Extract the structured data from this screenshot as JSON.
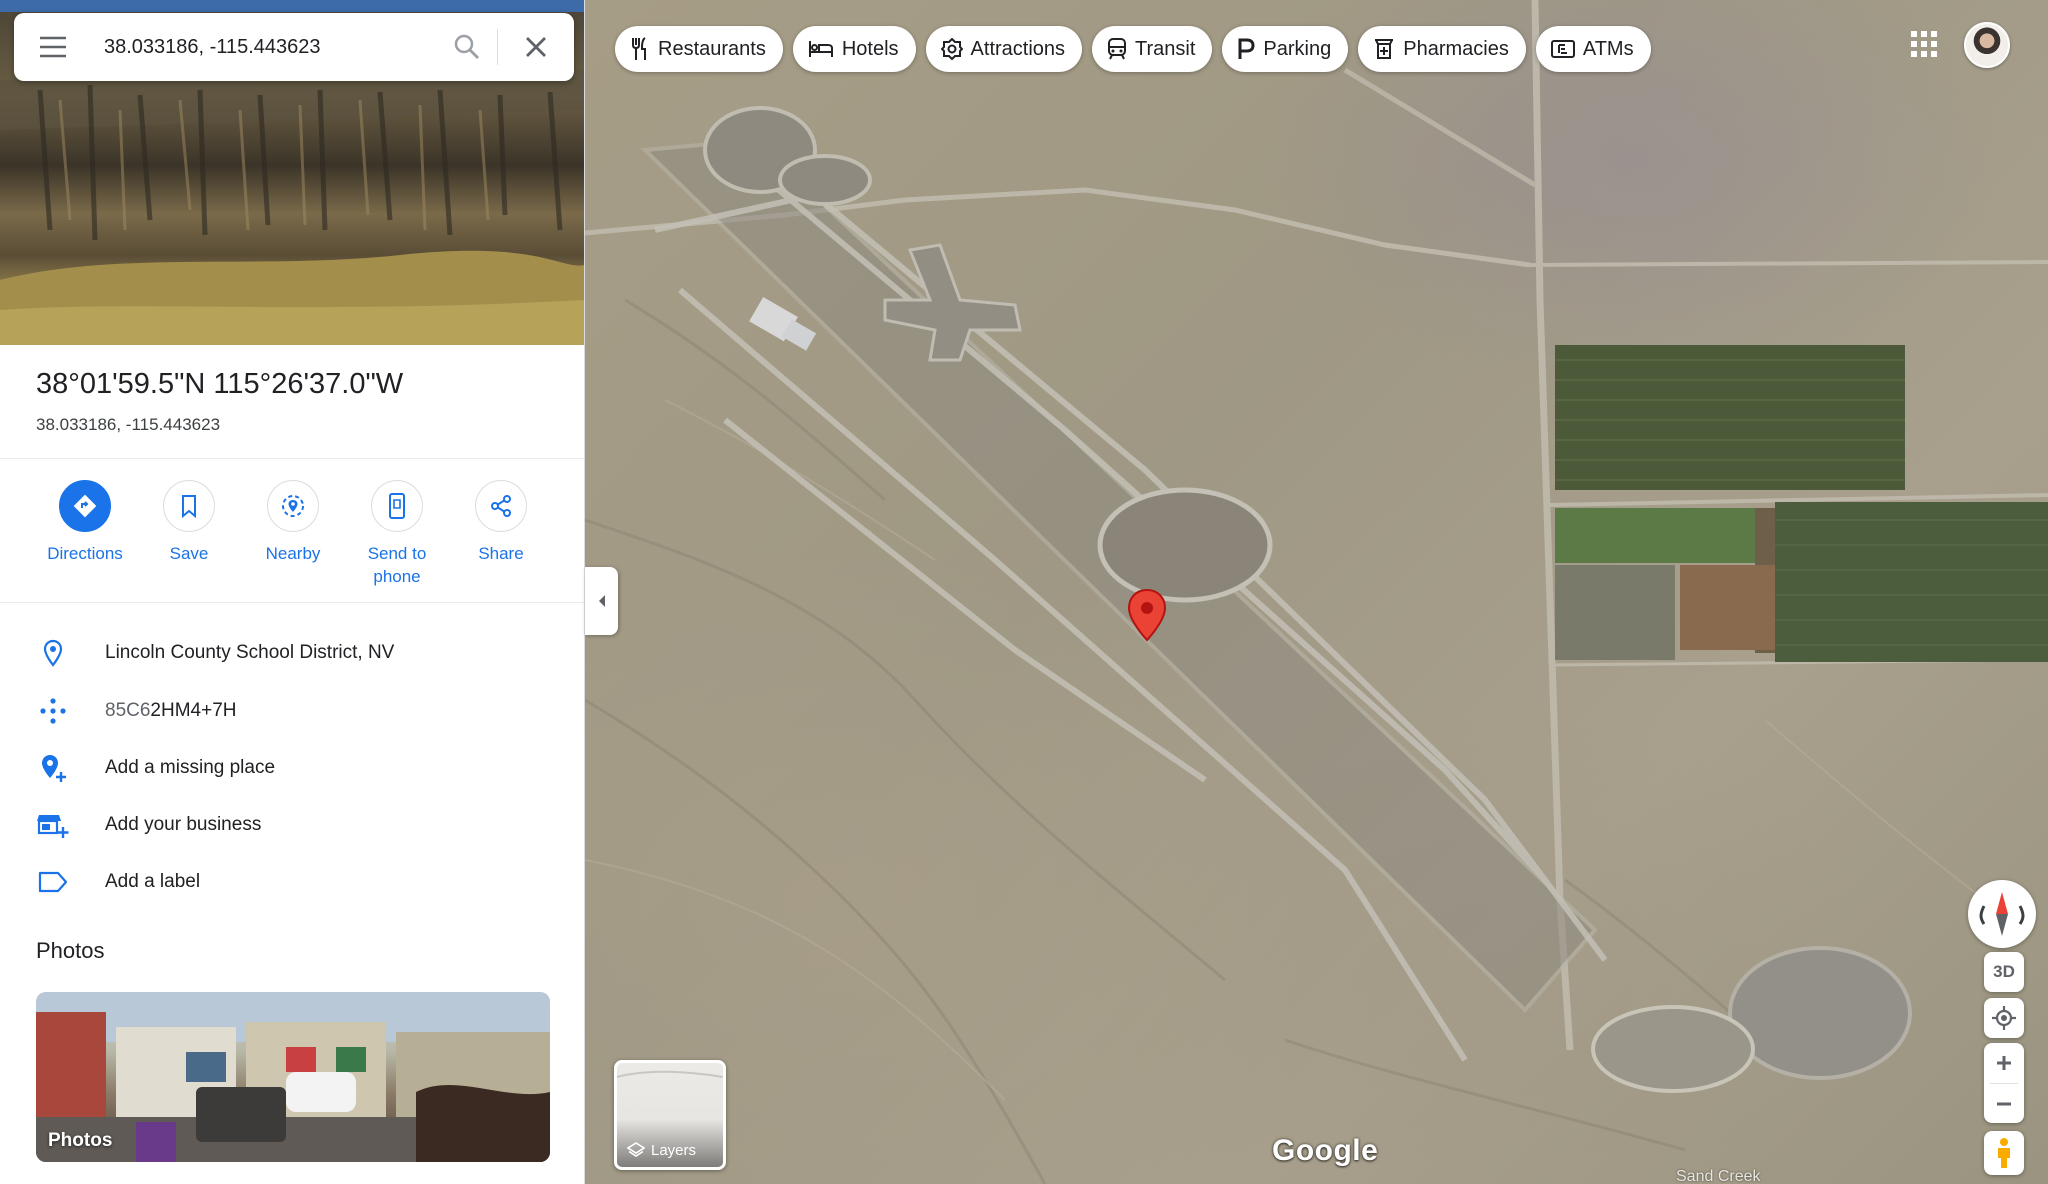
{
  "search": {
    "query": "38.033186, -115.443623"
  },
  "place": {
    "title": "38°01'59.5\"N 115°26'37.0\"W",
    "subtitle": "38.033186, -115.443623"
  },
  "actions": [
    {
      "label": "Directions"
    },
    {
      "label": "Save"
    },
    {
      "label": "Nearby"
    },
    {
      "label": "Send to phone"
    },
    {
      "label": "Share"
    }
  ],
  "info": {
    "address": "Lincoln County School District, NV",
    "plus_code_prefix": "85C6",
    "plus_code_rest": "2HM4+7H",
    "add_missing_place": "Add a missing place",
    "add_business": "Add your business",
    "add_label": "Add a label"
  },
  "photos": {
    "heading": "Photos",
    "card_label": "Photos"
  },
  "categories": [
    {
      "label": "Restaurants",
      "icon": "fork-knife-icon"
    },
    {
      "label": "Hotels",
      "icon": "bed-icon"
    },
    {
      "label": "Attractions",
      "icon": "camera-icon"
    },
    {
      "label": "Transit",
      "icon": "train-icon"
    },
    {
      "label": "Parking",
      "icon": "parking-icon"
    },
    {
      "label": "Pharmacies",
      "icon": "pharmacy-icon"
    },
    {
      "label": "ATMs",
      "icon": "atm-icon"
    }
  ],
  "map": {
    "control_3d": "3D",
    "layers_label": "Layers",
    "brand": "Google",
    "label_bottom": "Sand Creek"
  },
  "colors": {
    "accent": "#1a73e8",
    "pin": "#ea4335"
  }
}
